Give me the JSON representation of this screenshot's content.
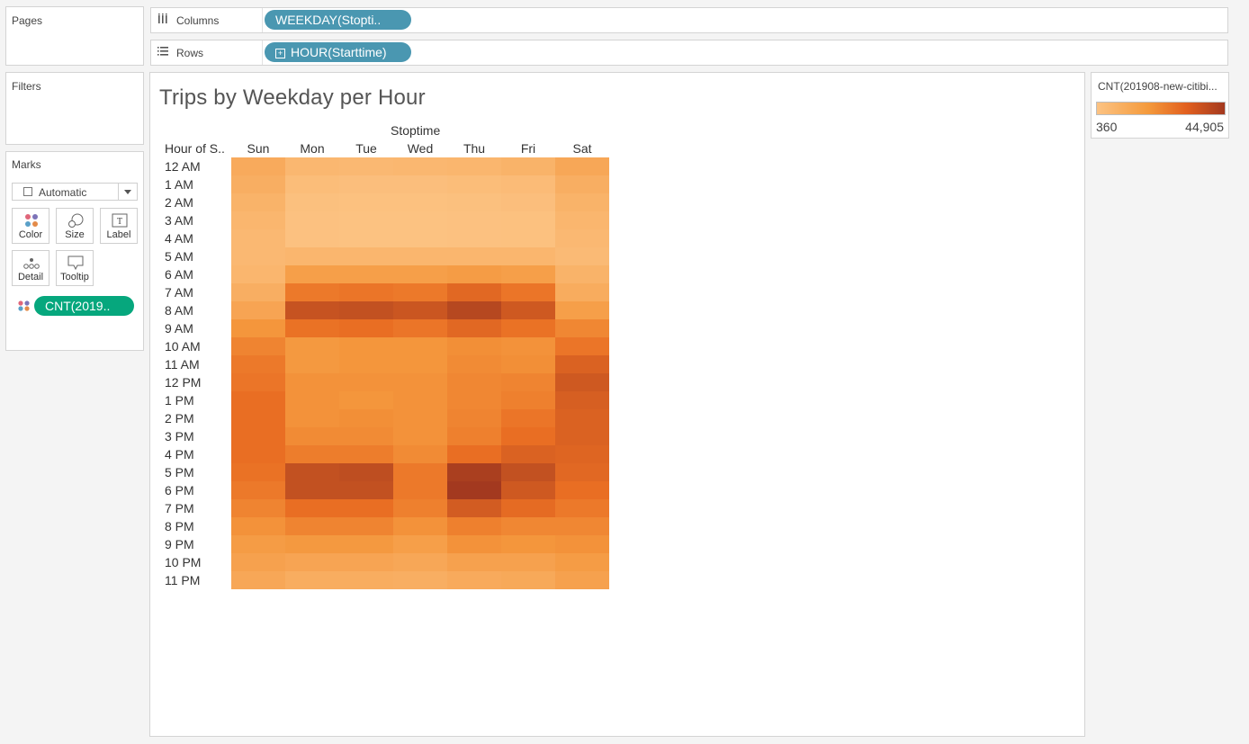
{
  "pages": {
    "title": "Pages"
  },
  "filters": {
    "title": "Filters"
  },
  "marks": {
    "title": "Marks",
    "mark_type": "Automatic",
    "buttons": [
      "Color",
      "Size",
      "Label",
      "Detail",
      "Tooltip"
    ],
    "color_pill": "CNT(2019.."
  },
  "shelves": {
    "columns": {
      "label": "Columns",
      "pill": "WEEKDAY(Stopti.."
    },
    "rows": {
      "label": "Rows",
      "pill": "HOUR(Starttime)"
    }
  },
  "legend": {
    "title": "CNT(201908-new-citibi...",
    "min_label": "360",
    "max_label": "44,905",
    "color_low": "#fcc383",
    "color_high": "#a3391f"
  },
  "viz": {
    "title": "Trips by Weekday per Hour",
    "column_group_title": "Stoptime",
    "row_header_title": "Hour of S.."
  },
  "chart_data": {
    "type": "heatmap",
    "title": "Trips by Weekday per Hour",
    "x_title": "Stoptime",
    "y_title": "Hour of S..",
    "columns": [
      "Sun",
      "Mon",
      "Tue",
      "Wed",
      "Thu",
      "Fri",
      "Sat"
    ],
    "rows": [
      "12 AM",
      "1 AM",
      "2 AM",
      "3 AM",
      "4 AM",
      "5 AM",
      "6 AM",
      "7 AM",
      "8 AM",
      "9 AM",
      "10 AM",
      "11 AM",
      "12 PM",
      "1 PM",
      "2 PM",
      "3 PM",
      "4 PM",
      "5 PM",
      "6 PM",
      "7 PM",
      "8 PM",
      "9 PM",
      "10 PM",
      "11 PM"
    ],
    "color_range": [
      360,
      44905
    ],
    "values": [
      [
        9000,
        4500,
        4000,
        4500,
        5000,
        6000,
        10000
      ],
      [
        7500,
        2500,
        2000,
        2000,
        2500,
        3000,
        7500
      ],
      [
        6000,
        1500,
        1200,
        1200,
        1500,
        2000,
        6000
      ],
      [
        5000,
        1000,
        800,
        800,
        1000,
        1200,
        5000
      ],
      [
        4000,
        1000,
        800,
        800,
        1000,
        1200,
        4000
      ],
      [
        4000,
        5000,
        5000,
        5000,
        5000,
        5000,
        3500
      ],
      [
        5000,
        13000,
        13000,
        13000,
        14000,
        13000,
        6000
      ],
      [
        7500,
        24000,
        25000,
        24000,
        29000,
        25000,
        8500
      ],
      [
        11000,
        36000,
        37000,
        35000,
        40000,
        34000,
        13000
      ],
      [
        16000,
        26000,
        27000,
        25000,
        29000,
        26000,
        20000
      ],
      [
        21000,
        15000,
        16000,
        16000,
        18000,
        17000,
        25000
      ],
      [
        24000,
        15000,
        16000,
        16000,
        19000,
        18000,
        31000
      ],
      [
        25000,
        17000,
        17000,
        17000,
        20000,
        21000,
        34000
      ],
      [
        27000,
        17000,
        16000,
        17000,
        20000,
        22000,
        32000
      ],
      [
        27000,
        17000,
        18000,
        17000,
        21000,
        25000,
        31000
      ],
      [
        27000,
        19000,
        19000,
        17000,
        22000,
        27000,
        31000
      ],
      [
        27000,
        23000,
        23000,
        19000,
        27000,
        31000,
        30000
      ],
      [
        26000,
        37000,
        38000,
        24000,
        43000,
        37000,
        29000
      ],
      [
        24000,
        37000,
        37000,
        24000,
        44905,
        34000,
        27000
      ],
      [
        21000,
        27000,
        27000,
        22000,
        33000,
        28000,
        24000
      ],
      [
        17000,
        21000,
        21000,
        17000,
        22000,
        20000,
        20000
      ],
      [
        14000,
        15000,
        15000,
        13000,
        17000,
        16000,
        17000
      ],
      [
        12000,
        11000,
        11000,
        10000,
        12000,
        12000,
        14000
      ],
      [
        10000,
        8000,
        8000,
        7500,
        9000,
        9500,
        12000
      ]
    ]
  }
}
